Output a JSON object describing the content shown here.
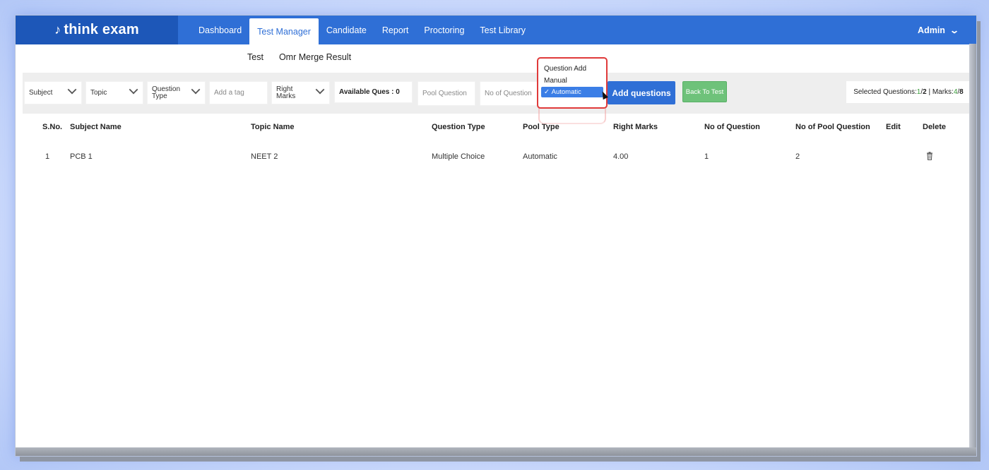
{
  "brand": {
    "logo_mark": "♪",
    "logo_text": "think exam"
  },
  "nav": {
    "items": [
      "Dashboard",
      "Test Manager",
      "Candidate",
      "Report",
      "Proctoring",
      "Test Library"
    ],
    "active": "Test Manager",
    "user": "Admin"
  },
  "subnav": {
    "items": [
      "Test",
      "Omr Merge Result"
    ]
  },
  "filters": {
    "subject": "Subject",
    "topic": "Topic",
    "question_type_l1": "Question",
    "question_type_l2": "Type",
    "tag_placeholder": "Add a tag",
    "right_marks_l1": "Right",
    "right_marks_l2": "Marks",
    "available_ques": "Available Ques : 0",
    "pool_question_placeholder": "Pool Question",
    "no_of_question_placeholder": "No of Question",
    "add_questions": "Add questions",
    "back_to_test": "Back To Test",
    "selected_label": "Selected Questions: ",
    "selected_value": "1",
    "selected_total": "2",
    "marks_label": "Marks:",
    "marks_value": "4",
    "marks_total": "8"
  },
  "dropdown": {
    "header": "Question Add",
    "options": [
      "Manual",
      "Automatic"
    ],
    "selected": "Automatic",
    "check": "✓"
  },
  "table": {
    "columns": [
      "S.No.",
      "Subject Name",
      "Topic Name",
      "Question Type",
      "Pool Type",
      "Right Marks",
      "No of Question",
      "No of Pool Question",
      "Edit",
      "Delete"
    ],
    "rows": [
      {
        "sno": "1",
        "subject": "PCB 1",
        "topic": "NEET 2",
        "qtype": "Multiple Choice",
        "pool": "Automatic",
        "marks": "4.00",
        "noq": "1",
        "nopool": "2"
      }
    ]
  },
  "colors": {
    "nav_bg": "#2f6fd6",
    "logo_bg": "#1d57b8",
    "accent_green": "#6ec27a",
    "popup_border": "#e03a3a"
  }
}
